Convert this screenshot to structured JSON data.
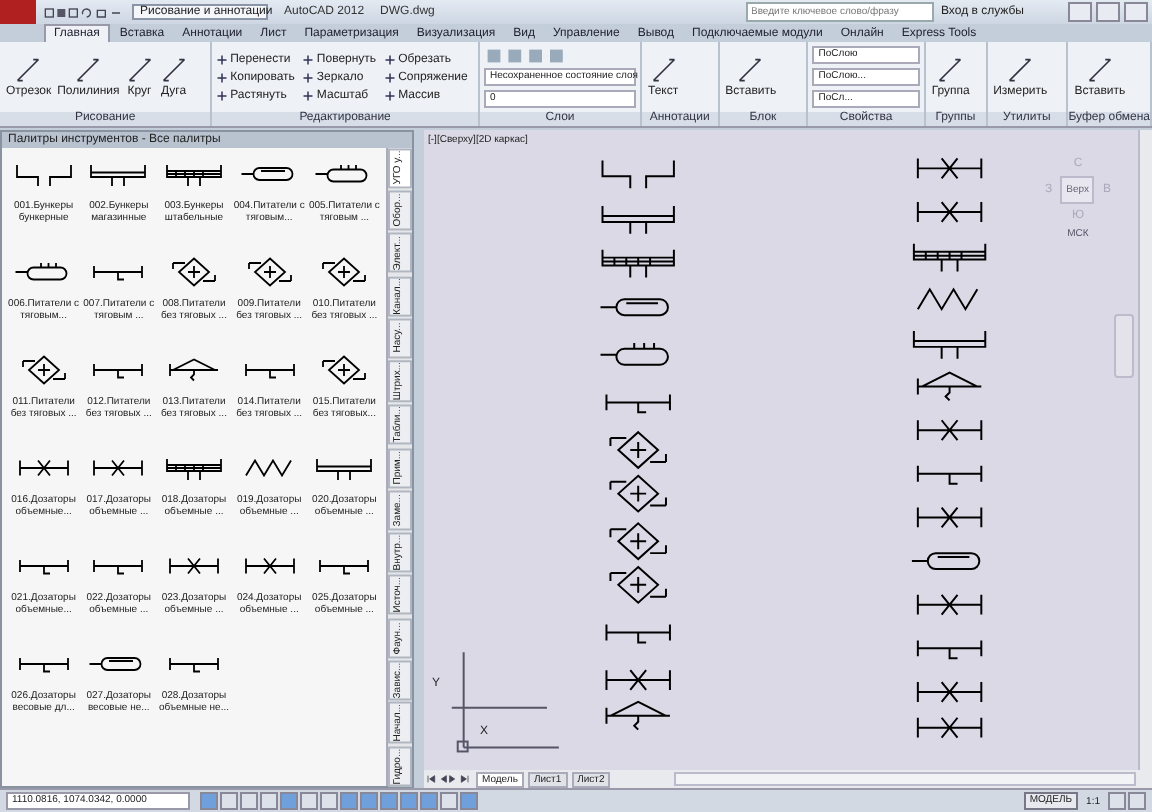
{
  "title_bar": {
    "workspace": "Рисование и аннотации",
    "title": "AutoCAD 2012",
    "file": "DWG.dwg",
    "search": {
      "placeholder": "Введите ключевое слово/фразу"
    },
    "sign_in": "Вход в службы"
  },
  "ribbon_tabs": [
    {
      "label": "Главная",
      "selected": true
    },
    {
      "label": "Вставка",
      "selected": false
    },
    {
      "label": "Аннотации",
      "selected": false
    },
    {
      "label": "Лист",
      "selected": false
    },
    {
      "label": "Параметризация",
      "selected": false
    },
    {
      "label": "Визуализация",
      "selected": false
    },
    {
      "label": "Вид",
      "selected": false
    },
    {
      "label": "Управление",
      "selected": false
    },
    {
      "label": "Вывод",
      "selected": false
    },
    {
      "label": "Подключаемые модули",
      "selected": false
    },
    {
      "label": "Онлайн",
      "selected": false
    },
    {
      "label": "Express Tools",
      "selected": false
    }
  ],
  "panels": [
    {
      "kind": "big",
      "title": "Рисование",
      "tools": [
        "Отрезок",
        "Полилиния",
        "Круг",
        "Дуга"
      ]
    },
    {
      "kind": "list",
      "title": "Редактирование",
      "tools": [
        "Перенести",
        "Повернуть",
        "Обрезать",
        "Копировать",
        "Зеркало",
        "Сопряжение",
        "Растянуть",
        "Масштаб",
        "Массив"
      ]
    },
    {
      "kind": "layers",
      "title": "Слои",
      "state": "Несохраненное состояние слоя",
      "layer": "0"
    },
    {
      "kind": "big",
      "title": "Аннотации",
      "tools": [
        "Текст"
      ]
    },
    {
      "kind": "big",
      "title": "Блок",
      "tools": [
        "Вставить"
      ]
    },
    {
      "kind": "props",
      "title": "Свойства",
      "values": [
        "ПоСлою",
        "ПоСлою...",
        "ПоСл..."
      ]
    },
    {
      "kind": "big",
      "title": "Группы",
      "tools": [
        "Группа"
      ]
    },
    {
      "kind": "big",
      "title": "Утилиты",
      "tools": [
        "Измерить"
      ]
    },
    {
      "kind": "big",
      "title": "Буфер обмена",
      "tools": [
        "Вставить"
      ]
    }
  ],
  "palette": {
    "title": "Палитры инструментов - Все палитры",
    "items": [
      "001.Бункеры бункерные",
      "002.Бункеры магазинные",
      "003.Бункеры штабельные",
      "004.Питатели с тяговым...",
      "005.Питатели с тяговым ...",
      "006.Питатели с тяговым...",
      "007.Питатели с тяговым ...",
      "008.Питатели без тяговых ...",
      "009.Питатели без тяговых ...",
      "010.Питатели без тяговых ...",
      "011.Питатели без тяговых ...",
      "012.Питатели без тяговых ...",
      "013.Питатели без тяговых ...",
      "014.Питатели без тяговых ...",
      "015.Питатели без тяговых...",
      "016.Дозаторы объемные...",
      "017.Дозаторы объемные ...",
      "018.Дозаторы объемные ...",
      "019.Дозаторы объемные ...",
      "020.Дозаторы объемные ...",
      "021.Дозаторы объемные...",
      "022.Дозаторы объемные ...",
      "023.Дозаторы объемные ...",
      "024.Дозаторы объемные ...",
      "025.Дозаторы объемные ...",
      "026.Дозаторы весовые дл...",
      "027.Дозаторы весовые не...",
      "028.Дозаторы объемные не..."
    ],
    "tabs": [
      {
        "label": "УГО у...",
        "selected": true
      },
      {
        "label": "Обор...",
        "selected": false
      },
      {
        "label": "Элект...",
        "selected": false
      },
      {
        "label": "Канал...",
        "selected": false
      },
      {
        "label": "Насу...",
        "selected": false
      },
      {
        "label": "Штрих...",
        "selected": false
      },
      {
        "label": "Табли...",
        "selected": false
      },
      {
        "label": "Прим...",
        "selected": false
      },
      {
        "label": "Заме...",
        "selected": false
      },
      {
        "label": "Внутр...",
        "selected": false
      },
      {
        "label": "Источ...",
        "selected": false
      },
      {
        "label": "Фаун...",
        "selected": false
      },
      {
        "label": "Завис...",
        "selected": false
      },
      {
        "label": "Начал...",
        "selected": false
      },
      {
        "label": "Гидро...",
        "selected": false
      }
    ]
  },
  "viewport": {
    "label": "[-][Сверху][2D каркас]",
    "view_cube": {
      "north": "С",
      "west": "З",
      "east": "В",
      "south": "Ю",
      "face": "Верх",
      "ucs": "МСК"
    },
    "ucs_x": "X",
    "ucs_y": "Y"
  },
  "layout_tabs": [
    {
      "label": "Модель",
      "selected": true
    },
    {
      "label": "Лист1",
      "selected": false
    },
    {
      "label": "Лист2",
      "selected": false
    }
  ],
  "status_bar": {
    "coordinates": "1110.0816, 1074.0342, 0.0000",
    "toggles": [
      {
        "on": true
      },
      {
        "on": false
      },
      {
        "on": false
      },
      {
        "on": false
      },
      {
        "on": true
      },
      {
        "on": false
      },
      {
        "on": false
      },
      {
        "on": true
      },
      {
        "on": true
      },
      {
        "on": true
      },
      {
        "on": true
      },
      {
        "on": true
      },
      {
        "on": false
      },
      {
        "on": true
      }
    ],
    "space": "МОДЕЛЬ",
    "scale": "1:1"
  }
}
